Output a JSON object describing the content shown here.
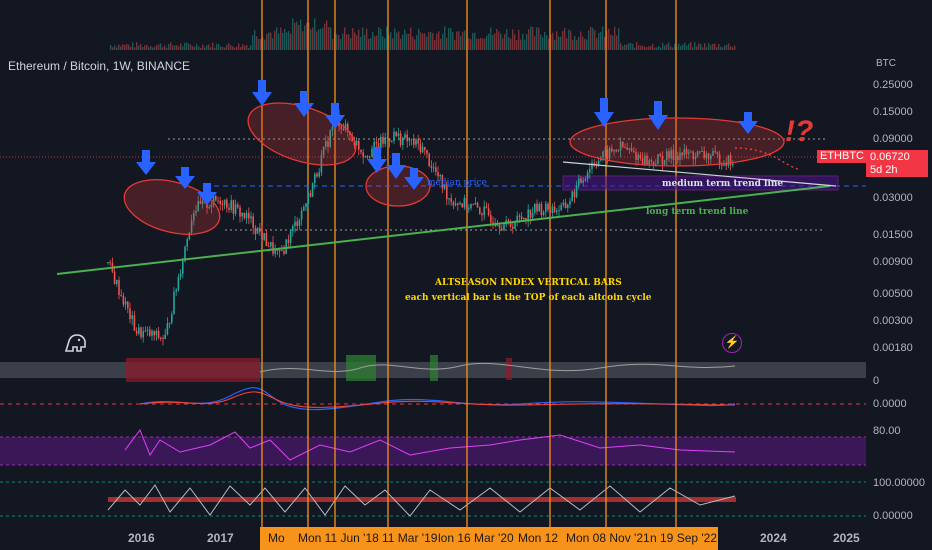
{
  "header": {
    "symbol_title": "Ethereum / Bitcoin, 1W, BINANCE"
  },
  "price_axis": {
    "unit": "BTC",
    "ticks": [
      "0.25000",
      "0.15000",
      "0.09000",
      "0.05000",
      "0.03000",
      "0.01500",
      "0.00900",
      "0.00500",
      "0.00300",
      "0.00180"
    ],
    "badge_symbol": "ETHBTC",
    "badge_price": "0.06720",
    "badge_countdown": "5d 2h"
  },
  "indicator_axes": {
    "pane1": "0",
    "pane2": "0.0000",
    "pane3": "80.00",
    "pane4_top": "100.00000",
    "pane4_bottom": "0.00000"
  },
  "time_axis": {
    "year_labels": [
      "2016",
      "2017",
      "2024",
      "2025"
    ],
    "date_labels": [
      "Mo",
      "Mon 11 Jun '18",
      "11 Mar '19",
      "lon 16 Mar '20",
      "Mon 12",
      "Mon 08 Nov '21",
      "n 19 Sep '22"
    ]
  },
  "annotations": {
    "altseason_title": "ALTSEASON INDEX VERTICAL BARS",
    "altseason_subtitle": "each vertical bar is the TOP of each altcoin  cycle",
    "median_price": "median price",
    "medium_trend": "medium term trend line",
    "long_trend": "long term trend line",
    "exclaim": "!?"
  },
  "colors": {
    "background": "#131722",
    "orange_bar": "#f7931a",
    "trend_green": "#4caf50",
    "ellipse_red": "#e53935",
    "arrow_blue": "#2962ff",
    "badge_red": "#f23645",
    "annotation_yellow": "#ffd600",
    "pink_line": "#d147a3",
    "purple_zone": "#7b1fa2"
  },
  "icons": [
    "tradingview-logo-icon",
    "lightning-icon"
  ],
  "chart_data": {
    "type": "line",
    "title": "Ethereum / Bitcoin, 1W, BINANCE",
    "ylabel": "BTC",
    "y_scale": "log",
    "ylim": [
      0.0015,
      0.3
    ],
    "x": [
      "2015-08",
      "2015-10",
      "2016-01",
      "2016-03",
      "2016-06",
      "2016-09",
      "2016-12",
      "2017-03",
      "2017-06",
      "2017-09",
      "2018-01",
      "2018-06",
      "2018-12",
      "2019-06",
      "2019-12",
      "2020-06",
      "2020-12",
      "2021-06",
      "2021-12",
      "2022-06",
      "2022-12",
      "2023-04",
      "2023-08"
    ],
    "series": [
      {
        "values": [
          0.009,
          0.0025,
          0.0022,
          0.025,
          0.03,
          0.02,
          0.01,
          0.03,
          0.14,
          0.07,
          0.1,
          0.08,
          0.03,
          0.025,
          0.018,
          0.025,
          0.025,
          0.06,
          0.08,
          0.06,
          0.07,
          0.068,
          0.06
        ]
      }
    ],
    "vertical_bar_dates": [
      "2018-01",
      "2018-06-11",
      "2018-12",
      "2019-03-11",
      "2020-03-16",
      "2021-04-12",
      "2021-11-08",
      "2022-09-19"
    ],
    "grid": false
  }
}
